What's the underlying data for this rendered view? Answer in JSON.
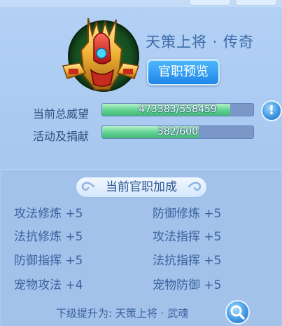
{
  "header": {
    "title": "天策上将 · 传奇",
    "preview_label": "官职预览"
  },
  "stats": {
    "prestige_label": "当前总威望",
    "prestige_text": "473383/558459",
    "prestige_current": 473383,
    "prestige_max": 558459,
    "activity_label": "活动及捐献",
    "activity_text": "382/600",
    "activity_current": 382,
    "activity_max": 600
  },
  "help_label": "!",
  "bonus_panel": {
    "title": "当前官职加成",
    "items": [
      {
        "name": "攻法修炼",
        "value": "+5"
      },
      {
        "name": "防御修炼",
        "value": "+5"
      },
      {
        "name": "法抗修炼",
        "value": "+5"
      },
      {
        "name": "攻法指挥",
        "value": "+5"
      },
      {
        "name": "防御指挥",
        "value": "+5"
      },
      {
        "name": "法抗指挥",
        "value": "+5"
      },
      {
        "name": "宠物攻法",
        "value": "+4"
      },
      {
        "name": "宠物防御",
        "value": "+5"
      }
    ]
  },
  "next_rank": {
    "label": "下级提升为:",
    "value": "天策上将 · 武魂"
  },
  "colors": {
    "background": "#a9c9f0",
    "bar_fill": "#5fd08f",
    "button_blue": "#1f86e6",
    "text_blue": "#3b62a0"
  },
  "icons": {
    "rank": "helmet-icon",
    "help": "exclamation-icon",
    "next": "search-icon"
  }
}
